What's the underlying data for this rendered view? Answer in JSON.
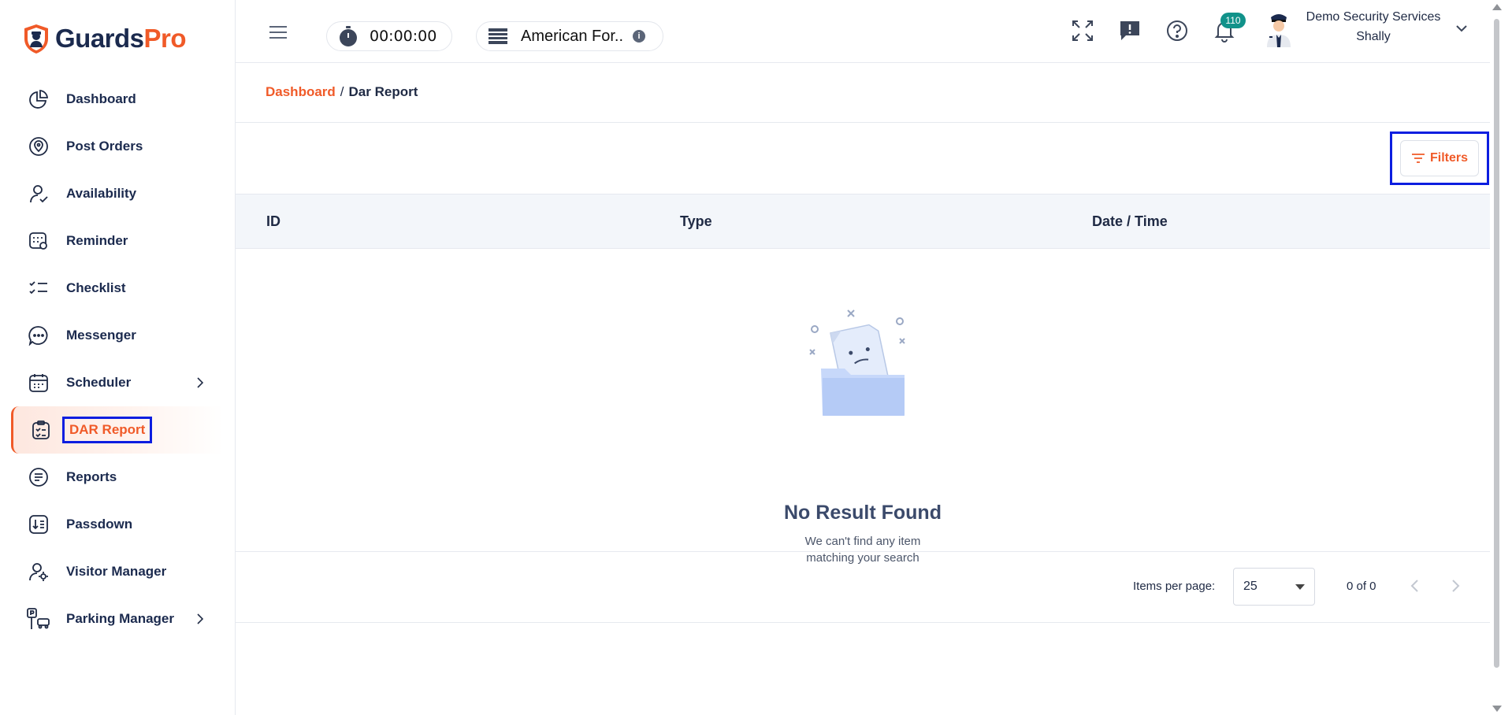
{
  "brand": {
    "name_part1": "Guards",
    "name_part2": "Pro",
    "accent": "#f05a28",
    "navy": "#1b2a4e"
  },
  "sidebar": {
    "items": [
      {
        "label": "Dashboard",
        "icon": "pie-chart-icon"
      },
      {
        "label": "Post Orders",
        "icon": "location-pin-icon"
      },
      {
        "label": "Availability",
        "icon": "user-check-icon"
      },
      {
        "label": "Reminder",
        "icon": "calendar-alarm-icon"
      },
      {
        "label": "Checklist",
        "icon": "checklist-icon"
      },
      {
        "label": "Messenger",
        "icon": "chat-bubble-icon"
      },
      {
        "label": "Scheduler",
        "icon": "calendar-icon",
        "has_submenu": true
      },
      {
        "label": "DAR Report",
        "icon": "clipboard-check-icon",
        "active": true
      },
      {
        "label": "Reports",
        "icon": "document-lines-icon"
      },
      {
        "label": "Passdown",
        "icon": "download-list-icon"
      },
      {
        "label": "Visitor Manager",
        "icon": "user-gear-icon"
      },
      {
        "label": "Parking Manager",
        "icon": "parking-icon",
        "has_submenu": true
      }
    ]
  },
  "topbar": {
    "timer": "00:00:00",
    "site": "American For..",
    "notifications_count": "110",
    "user_company": "Demo Security Services",
    "user_name": "Shally"
  },
  "breadcrumb": {
    "root": "Dashboard",
    "separator": "/",
    "current": "Dar Report"
  },
  "toolbar": {
    "filters_label": "Filters"
  },
  "table": {
    "columns": [
      "ID",
      "Type",
      "Date / Time"
    ]
  },
  "empty_state": {
    "title": "No Result Found",
    "line1": "We can't find any item",
    "line2": "matching your search"
  },
  "pagination": {
    "items_per_page_label": "Items per page:",
    "page_size": "25",
    "range": "0 of 0"
  }
}
